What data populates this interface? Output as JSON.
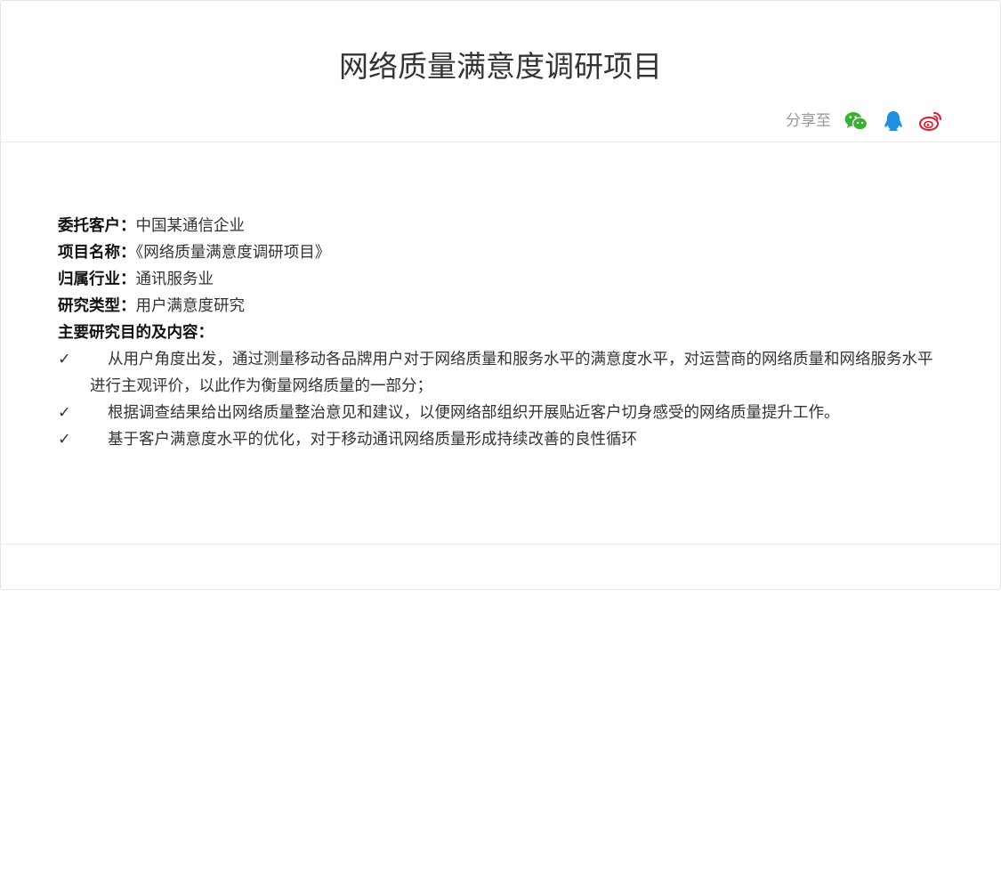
{
  "article": {
    "title": "网络质量满意度调研项目"
  },
  "share": {
    "label": "分享至",
    "icons": [
      "wechat-icon",
      "qq-icon",
      "weibo-icon"
    ],
    "colors": {
      "wechat": "#3cb034",
      "qq": "#1e8fe1",
      "weibo": "#e6162d"
    }
  },
  "details": {
    "client_label": "委托客户：",
    "client_value": "中国某通信企业",
    "name_label": "项目名称：",
    "name_value": "《网络质量满意度调研项目》",
    "industry_label": "归属行业：",
    "industry_value": "通讯服务业",
    "type_label": "研究类型：",
    "type_value": "用户满意度研究",
    "goals_label": "主要研究目的及内容："
  },
  "bullets": [
    {
      "mark": "✓",
      "text": "从用户角度出发，通过测量移动各品牌用户对于网络质量和服务水平的满意度水平，对运营商的网络质量和网络服务水平进行主观评价，以此作为衡量网络质量的一部分；"
    },
    {
      "mark": "✓",
      "text": "根据调查结果给出网络质量整治意见和建议，以便网络部组织开展贴近客户切身感受的网络质量提升工作。"
    },
    {
      "mark": "✓",
      "text": "基于客户满意度水平的优化，对于移动通讯网络质量形成持续改善的良性循环"
    }
  ]
}
